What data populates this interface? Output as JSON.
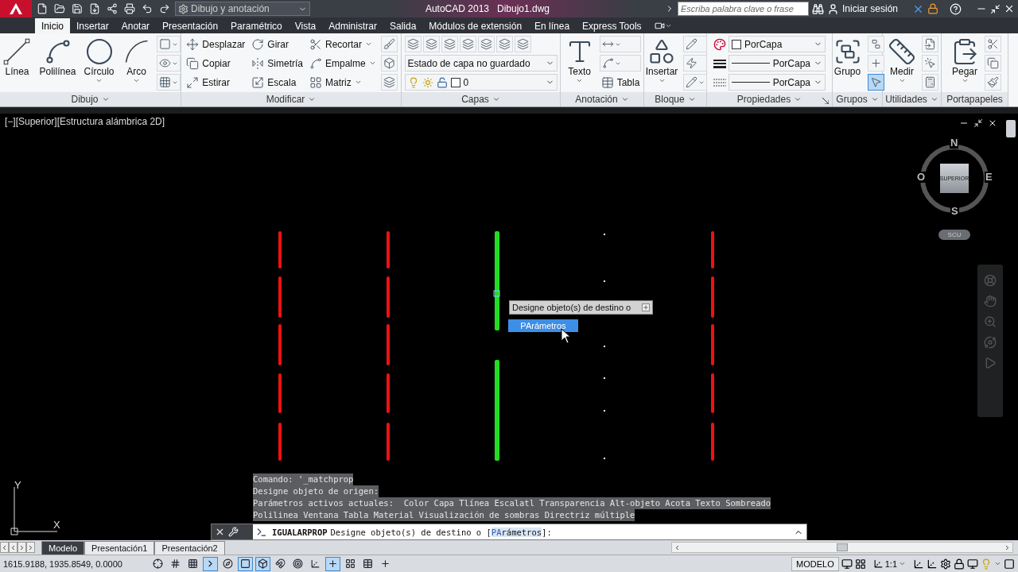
{
  "title_bar": {
    "workspace": "Dibujo y anotación",
    "app": "AutoCAD 2013",
    "file": "Dibujo1.dwg",
    "search_placeholder": "Escriba palabra clave o frase",
    "sign_in": "Iniciar sesión"
  },
  "ribbon_tabs": [
    {
      "label": "Inicio",
      "selected": true
    },
    {
      "label": "Insertar",
      "selected": false
    },
    {
      "label": "Anotar",
      "selected": false
    },
    {
      "label": "Presentación",
      "selected": false
    },
    {
      "label": "Paramétrico",
      "selected": false
    },
    {
      "label": "Vista",
      "selected": false
    },
    {
      "label": "Administrar",
      "selected": false
    },
    {
      "label": "Salida",
      "selected": false
    },
    {
      "label": "Módulos de extensión",
      "selected": false
    },
    {
      "label": "En línea",
      "selected": false
    },
    {
      "label": "Express Tools",
      "selected": false
    }
  ],
  "panels": [
    {
      "title": "Dibujo",
      "menu": true,
      "launcher": false,
      "columns": [
        [
          {
            "kind": "large",
            "label": "Línea",
            "menu": false
          }
        ],
        [
          {
            "kind": "large",
            "label": "Polilínea",
            "menu": false
          }
        ],
        [
          {
            "kind": "large",
            "label": "Círculo",
            "menu": true
          }
        ],
        [
          {
            "kind": "large",
            "label": "Arco",
            "menu": true
          }
        ],
        [
          {
            "kind": "icon",
            "menu": true,
            "active": false
          },
          {
            "kind": "icon",
            "menu": true,
            "active": false
          },
          {
            "kind": "icon",
            "menu": true,
            "active": false
          }
        ]
      ]
    },
    {
      "title": "Modificar",
      "menu": true,
      "launcher": false,
      "columns": [
        [
          {
            "kind": "small",
            "label": "Desplazar",
            "menu": false
          },
          {
            "kind": "small",
            "label": "Copiar",
            "menu": false
          },
          {
            "kind": "small",
            "label": "Estirar",
            "menu": false
          }
        ],
        [
          {
            "kind": "small",
            "label": "Girar",
            "menu": false
          },
          {
            "kind": "small",
            "label": "Simetría",
            "menu": false
          },
          {
            "kind": "small",
            "label": "Escala",
            "menu": false
          }
        ],
        [
          {
            "kind": "small",
            "label": "Recortar",
            "menu": true
          },
          {
            "kind": "small",
            "label": "Empalme",
            "menu": true
          },
          {
            "kind": "small",
            "label": "Matriz",
            "menu": true
          }
        ],
        [
          {
            "kind": "icon",
            "menu": false,
            "active": false
          },
          {
            "kind": "icon",
            "menu": false,
            "active": false
          },
          {
            "kind": "icon",
            "menu": false,
            "active": false
          }
        ]
      ]
    },
    {
      "title": "Capas",
      "menu": true,
      "launcher": false,
      "columns": [
        [
          {
            "kind": "icons"
          },
          {
            "kind": "select",
            "value": "Estado de capa no guardado"
          },
          {
            "kind": "layer",
            "value": "0"
          }
        ]
      ]
    },
    {
      "title": "Anotación",
      "menu": true,
      "launcher": false,
      "columns": [
        [
          {
            "kind": "large",
            "label": "Texto",
            "menu": true
          }
        ],
        [
          {
            "kind": "icon",
            "menu": true,
            "active": false
          },
          {
            "kind": "icon",
            "menu": true,
            "active": false
          },
          {
            "kind": "small",
            "label": "Tabla",
            "menu": false
          }
        ]
      ]
    },
    {
      "title": "Bloque",
      "menu": true,
      "launcher": false,
      "columns": [
        [
          {
            "kind": "large",
            "label": "Insertar",
            "menu": true
          }
        ],
        [
          {
            "kind": "icon",
            "menu": false,
            "active": false
          },
          {
            "kind": "icon",
            "menu": false,
            "active": false
          },
          {
            "kind": "icon",
            "menu": true,
            "active": false
          }
        ]
      ]
    },
    {
      "title": "Propiedades",
      "menu": true,
      "launcher": true,
      "columns": [
        [
          {
            "kind": "color_select",
            "value": "PorCapa"
          },
          {
            "kind": "line_select",
            "value": "PorCapa"
          },
          {
            "kind": "line_select",
            "value": "PorCapa"
          }
        ]
      ]
    },
    {
      "title": "Grupos",
      "menu": true,
      "launcher": false,
      "columns": [
        [
          {
            "kind": "large",
            "label": "Grupo",
            "menu": false
          }
        ],
        [
          {
            "kind": "icon",
            "menu": false,
            "active": false
          },
          {
            "kind": "icon",
            "menu": false,
            "active": false
          },
          {
            "kind": "icon",
            "menu": false,
            "active": true
          }
        ]
      ]
    },
    {
      "title": "Utilidades",
      "menu": true,
      "launcher": false,
      "columns": [
        [
          {
            "kind": "large",
            "label": "Medir",
            "menu": true
          }
        ],
        [
          {
            "kind": "icon",
            "menu": false,
            "active": false
          },
          {
            "kind": "icon",
            "menu": false,
            "active": false
          },
          {
            "kind": "icon",
            "menu": false,
            "active": false
          }
        ]
      ]
    },
    {
      "title": "Portapapeles",
      "menu": false,
      "launcher": false,
      "columns": [
        [
          {
            "kind": "large",
            "label": "Pegar",
            "menu": true
          }
        ],
        [
          {
            "kind": "icon",
            "menu": false,
            "active": false
          },
          {
            "kind": "icon",
            "menu": false,
            "active": false
          },
          {
            "kind": "icon",
            "menu": false,
            "active": false
          }
        ]
      ]
    }
  ],
  "viewport": {
    "label": "[−][Superior][Estructura alámbrica 2D]",
    "columns": [
      {
        "kind": "dashed",
        "selected": false
      },
      {
        "kind": "dashed",
        "selected": false
      },
      {
        "kind": "dashed",
        "selected": true
      },
      {
        "kind": "dotted",
        "selected": false
      },
      {
        "kind": "dashed",
        "selected": false
      }
    ],
    "tooltip": "Designe objeto(s) de destino o",
    "options": [
      {
        "label": "PArámetros",
        "selected": true
      }
    ],
    "viewcube": {
      "north": "N",
      "south": "S",
      "east": "E",
      "west": "O",
      "face": "SUPERIOR",
      "ucs": "SCU"
    },
    "ucs_icon": {
      "x": "X",
      "y": "Y"
    }
  },
  "command_history": [
    "Comando: '_matchprop",
    "Designe objeto de origen:",
    "Parámetros activos actuales:  Color Capa Tlínea Escalatl Transparencia Alt-objeto Acota Texto Sombreado",
    "Polilinea Ventana Tabla Material Visualización de sombras Directriz múltiple"
  ],
  "command_line": {
    "command": "IGUALARPROP",
    "prompt": "Designe objeto(s) de destino o [",
    "option_key": "PA",
    "option_rest": "rámetros",
    "prompt_end": "]:"
  },
  "layout_tabs": [
    {
      "label": "Modelo",
      "selected": true
    },
    {
      "label": "Presentación1",
      "selected": false
    },
    {
      "label": "Presentación2",
      "selected": false
    }
  ],
  "status_bar": {
    "coordinates": "1615.9188, 1935.8549, 0.0000",
    "toggles": [
      {
        "on": false
      },
      {
        "on": false
      },
      {
        "on": false
      },
      {
        "on": true
      },
      {
        "on": false
      },
      {
        "on": true
      },
      {
        "on": true
      },
      {
        "on": false
      },
      {
        "on": false
      },
      {
        "on": false
      },
      {
        "on": true
      },
      {
        "on": false
      },
      {
        "on": false
      },
      {
        "on": false
      }
    ],
    "space": "MODELO",
    "scale": "1:1"
  }
}
